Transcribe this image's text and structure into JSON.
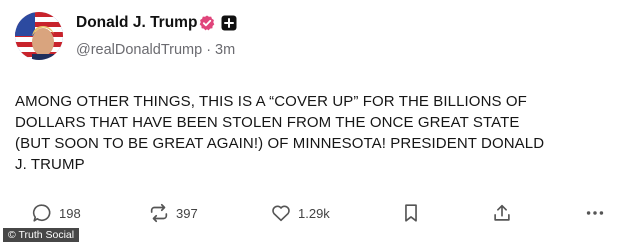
{
  "author": {
    "display_name": "Donald J. Trump",
    "handle": "@realDonaldTrump",
    "separator": "·",
    "timestamp": "3m"
  },
  "post": {
    "text": "AMONG OTHER THINGS, THIS IS A “COVER UP” FOR THE BILLIONS OF\nDOLLARS THAT HAVE BEEN STOLEN FROM THE ONCE GREAT STATE\n(BUT SOON TO BE GREAT AGAIN!) OF MINNESOTA! PRESIDENT DONALD\nJ. TRUMP"
  },
  "actions": {
    "replies": "198",
    "retruths": "397",
    "likes": "1.29k"
  },
  "watermark": "© Truth Social",
  "colors": {
    "verified_badge": "#e0457b",
    "icon_gray": "#555555",
    "handle_gray": "#6b6b70"
  },
  "icons": {
    "verified": "verified-badge-icon",
    "badge": "plus-square-icon",
    "reply": "reply-icon",
    "retruth": "retruth-icon",
    "like": "heart-icon",
    "bookmark": "bookmark-icon",
    "share": "share-icon",
    "more": "more-icon"
  }
}
